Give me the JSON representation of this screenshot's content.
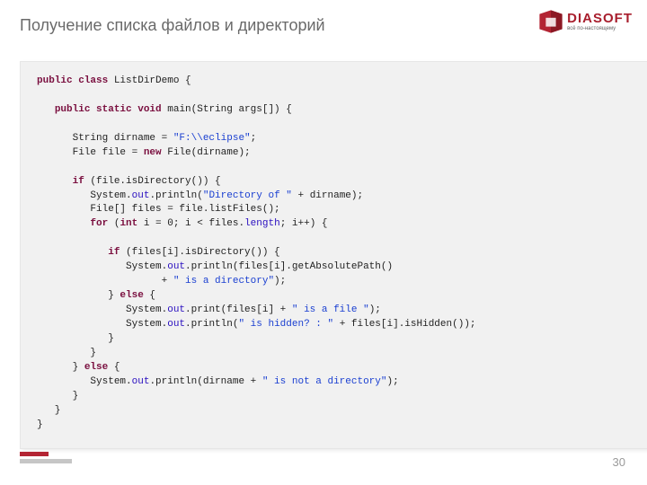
{
  "title": "Получение списка файлов и директорий",
  "logo": {
    "name": "DIASOFT",
    "tagline": "всё по-настоящему"
  },
  "page_number": "30",
  "code": {
    "tokens": [
      [
        [
          "kw",
          "public class"
        ],
        [
          "",
          " ListDirDemo {"
        ]
      ],
      [
        [
          "",
          ""
        ]
      ],
      [
        [
          "",
          "   "
        ],
        [
          "kw",
          "public static void"
        ],
        [
          "",
          " main(String args[]) {"
        ]
      ],
      [
        [
          "",
          ""
        ]
      ],
      [
        [
          "",
          "      String dirname = "
        ],
        [
          "str",
          "\"F:\\\\eclipse\""
        ],
        [
          "",
          ";"
        ]
      ],
      [
        [
          "",
          "      File file = "
        ],
        [
          "kw",
          "new"
        ],
        [
          "",
          " File(dirname);"
        ]
      ],
      [
        [
          "",
          ""
        ]
      ],
      [
        [
          "",
          "      "
        ],
        [
          "kw",
          "if"
        ],
        [
          "",
          " (file.isDirectory()) {"
        ]
      ],
      [
        [
          "",
          "         System."
        ],
        [
          "fld",
          "out"
        ],
        [
          "",
          ".println("
        ],
        [
          "str",
          "\"Directory of \""
        ],
        [
          "",
          " + dirname);"
        ]
      ],
      [
        [
          "",
          "         File[] files = file.listFiles();"
        ]
      ],
      [
        [
          "",
          "         "
        ],
        [
          "kw",
          "for"
        ],
        [
          "",
          " ("
        ],
        [
          "kw",
          "int"
        ],
        [
          "",
          " i = 0; i < files."
        ],
        [
          "fld",
          "length"
        ],
        [
          "",
          "; i++) {"
        ]
      ],
      [
        [
          "",
          ""
        ]
      ],
      [
        [
          "",
          "            "
        ],
        [
          "kw",
          "if"
        ],
        [
          "",
          " (files[i].isDirectory()) {"
        ]
      ],
      [
        [
          "",
          "               System."
        ],
        [
          "fld",
          "out"
        ],
        [
          "",
          ".println(files[i].getAbsolutePath()"
        ]
      ],
      [
        [
          "",
          "                     + "
        ],
        [
          "str",
          "\" is a directory\""
        ],
        [
          "",
          ");"
        ]
      ],
      [
        [
          "",
          "            } "
        ],
        [
          "kw",
          "else"
        ],
        [
          "",
          " {"
        ]
      ],
      [
        [
          "",
          "               System."
        ],
        [
          "fld",
          "out"
        ],
        [
          "",
          ".print(files[i] + "
        ],
        [
          "str",
          "\" is a file \""
        ],
        [
          "",
          ");"
        ]
      ],
      [
        [
          "",
          "               System."
        ],
        [
          "fld",
          "out"
        ],
        [
          "",
          ".println("
        ],
        [
          "str",
          "\" is hidden? : \""
        ],
        [
          "",
          " + files[i].isHidden());"
        ]
      ],
      [
        [
          "",
          "            }"
        ]
      ],
      [
        [
          "",
          "         }"
        ]
      ],
      [
        [
          "",
          "      } "
        ],
        [
          "kw",
          "else"
        ],
        [
          "",
          " {"
        ]
      ],
      [
        [
          "",
          "         System."
        ],
        [
          "fld",
          "out"
        ],
        [
          "",
          ".println(dirname + "
        ],
        [
          "str",
          "\" is not a directory\""
        ],
        [
          "",
          ");"
        ]
      ],
      [
        [
          "",
          "      }"
        ]
      ],
      [
        [
          "",
          "   }"
        ]
      ],
      [
        [
          "",
          "}"
        ]
      ]
    ]
  }
}
